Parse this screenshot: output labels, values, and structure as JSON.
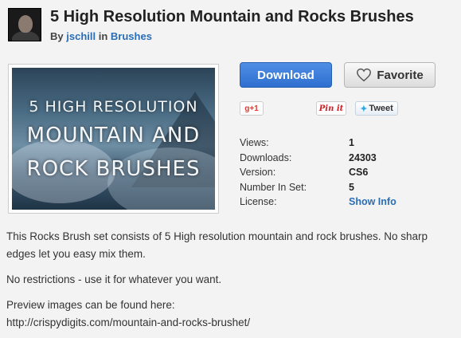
{
  "header": {
    "title": "5 High Resolution Mountain and Rocks Brushes",
    "by_prefix": "By",
    "author": "jschill",
    "in_word": "in",
    "category": "Brushes"
  },
  "preview": {
    "line1": "5 HIGH RESOLUTION",
    "line2": "MOUNTAIN AND",
    "line3": "ROCK BRUSHES"
  },
  "actions": {
    "download_label": "Download",
    "favorite_label": "Favorite",
    "favorite_icon": "heart-outline-icon"
  },
  "social": {
    "gplus_label": "g+1",
    "pinit_label": "Pin it",
    "tweet_label": "Tweet"
  },
  "info": [
    {
      "key": "Views:",
      "value": "1"
    },
    {
      "key": "Downloads:",
      "value": "24303"
    },
    {
      "key": "Version:",
      "value": "CS6"
    },
    {
      "key": "Number In Set:",
      "value": "5"
    },
    {
      "key": "License:",
      "value": "Show Info"
    }
  ],
  "description": {
    "para1": "This Rocks Brush set consists of 5 High resolution mountain and rock brushes. No sharp edges let you easy mix them.",
    "para2": "No restrictions - use it for whatever you want.",
    "para3": "Preview images can be found here:",
    "url": "http://crispydigits.com/mountain-and-rocks-brushet/"
  },
  "colors": {
    "accent_blue": "#2f6fcf",
    "link_blue": "#2a6eb5",
    "background": "#f3f3f3"
  }
}
